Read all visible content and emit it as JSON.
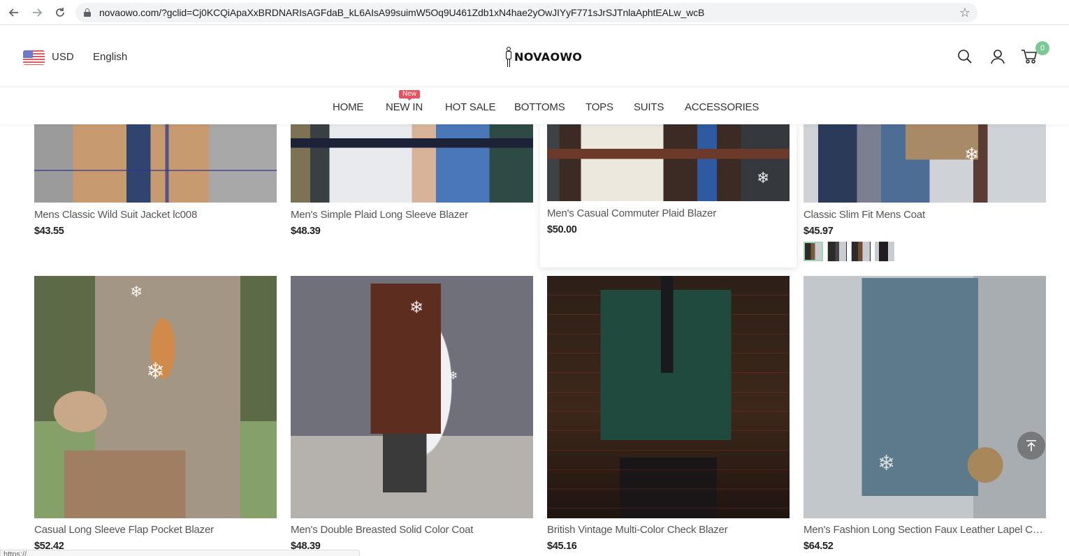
{
  "browser": {
    "url": "novaowo.com/?gclid=Cj0KCQiApaXxBRDNARIsAGFdaB_kL6AIsA99suimW5Oq9U461Zdb1xN4hae2yOwJIYyF771sJrSJTnlaAphtEALw_wcB",
    "status_url": "https://..."
  },
  "header": {
    "currency": "USD",
    "language": "English",
    "logo_text": "NOVAOWO",
    "cart_count": "0",
    "cart_badge_color": "#7dc995"
  },
  "nav": {
    "items": [
      {
        "label": "HOME"
      },
      {
        "label": "NEW IN",
        "badge": "New"
      },
      {
        "label": "HOT SALE"
      },
      {
        "label": "BOTTOMS"
      },
      {
        "label": "TOPS"
      },
      {
        "label": "SUITS"
      },
      {
        "label": "ACCESSORIES"
      }
    ],
    "badge_color": "#e8525e"
  },
  "products": [
    {
      "name": "Mens Classic Wild Suit Jacket lc008",
      "price": "$43.55"
    },
    {
      "name": "Men's Simple Plaid Long Sleeve Blazer",
      "price": "$48.39"
    },
    {
      "name": "Men's Casual Commuter Plaid Blazer",
      "price": "$50.00"
    },
    {
      "name": "Classic Slim Fit Mens Coat",
      "price": "$45.97",
      "swatch_count": 4
    },
    {
      "name": "Casual Long Sleeve Flap Pocket Blazer",
      "price": "$52.42"
    },
    {
      "name": "Men's Double Breasted Solid Color Coat",
      "price": "$48.39"
    },
    {
      "name": "British Vintage Multi-Color Check Blazer",
      "price": "$45.16"
    },
    {
      "name": "Men's Fashion Long Section Faux Leather Lapel Co...",
      "price": "$64.52"
    }
  ],
  "icons": {
    "snowflake": "❄"
  }
}
